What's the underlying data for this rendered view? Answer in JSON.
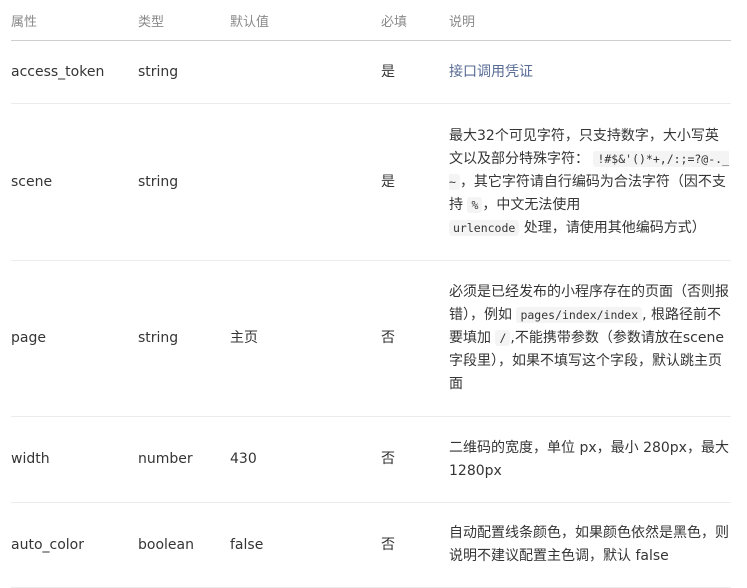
{
  "table": {
    "headers": {
      "name": "属性",
      "type": "类型",
      "default": "默认值",
      "required": "必填",
      "desc": "说明"
    },
    "rows": [
      {
        "name": "access_token",
        "type": "string",
        "default": "",
        "required": "是",
        "desc_link": "接口调用凭证"
      },
      {
        "name": "scene",
        "type": "string",
        "default": "",
        "required": "是",
        "desc_part1": "最大32个可见字符，只支持数字，大小写英文以及部分特殊字符：",
        "desc_code1": "!#$&'()*+,/:;=?@-._~",
        "desc_part2": "，其它字符请自行编码为合法字符（因不支持",
        "desc_code2": "%",
        "desc_part3": "，中文无法使用",
        "desc_code3": "urlencode",
        "desc_part4": "处理，请使用其他编码方式）"
      },
      {
        "name": "page",
        "type": "string",
        "default": "主页",
        "required": "否",
        "desc_part1": "必须是已经发布的小程序存在的页面（否则报错），例如",
        "desc_code1": "pages/index/index",
        "desc_part2": ", 根路径前不要填加",
        "desc_code2": "/",
        "desc_part3": ",不能携带参数（参数请放在scene字段里），如果不填写这个字段，默认跳主页面"
      },
      {
        "name": "width",
        "type": "number",
        "default": "430",
        "required": "否",
        "desc": "二维码的宽度，单位 px，最小 280px，最大 1280px"
      },
      {
        "name": "auto_color",
        "type": "boolean",
        "default": "false",
        "required": "否",
        "desc": "自动配置线条颜色，如果颜色依然是黑色，则说明不建议配置主色调，默认 false"
      }
    ]
  },
  "colors": {
    "link": "#576b95",
    "header_text": "#8a8a8a",
    "body_text": "#353535",
    "code_bg": "#f4f4f4"
  }
}
